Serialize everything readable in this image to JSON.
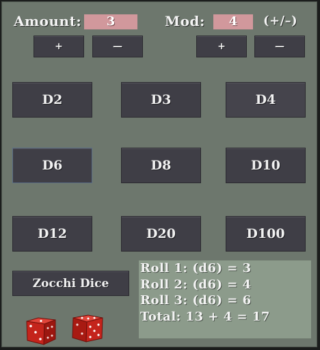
{
  "header": {
    "amount_label": "Amount:",
    "amount_value": "3",
    "mod_label": "Mod:",
    "mod_value": "4",
    "mod_hint": "(+/–)"
  },
  "steppers": {
    "amount_plus": "+",
    "amount_minus": "—",
    "mod_plus": "+",
    "mod_minus": "—"
  },
  "dice_buttons": [
    "D2",
    "D3",
    "D4",
    "D6",
    "D8",
    "D10",
    "D12",
    "D20",
    "D100"
  ],
  "zocchi_label": "Zocchi Dice",
  "output": {
    "lines": [
      "Roll 1: (d6) = 3",
      "Roll 2: (d6) = 4",
      "Roll 3: (d6) = 6",
      "Total: 13 + 4 = 17"
    ]
  },
  "icons": [
    "red-die-icon",
    "red-die-icon"
  ],
  "colors": {
    "background": "#6d776d",
    "button": "#3f3e46",
    "value_box": "#d1989c",
    "output_panel": "#8c9b8b",
    "die": "#c4241c"
  }
}
